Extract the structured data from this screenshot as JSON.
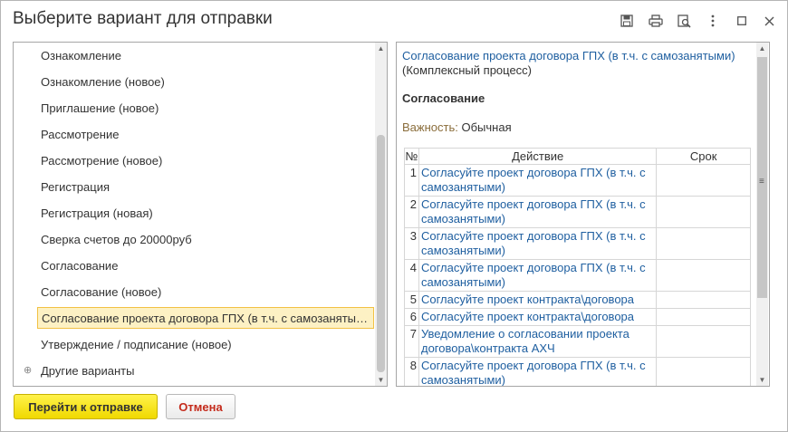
{
  "window": {
    "title": "Выберите вариант для отправки",
    "toolbar": [
      "save-icon",
      "print-icon",
      "preview-icon",
      "more-icon",
      "maximize-icon",
      "close-icon"
    ]
  },
  "variants": {
    "items": [
      "Ознакомление",
      "Ознакомление (новое)",
      "Приглашение (новое)",
      "Рассмотрение",
      "Рассмотрение (новое)",
      "Регистрация",
      "Регистрация (новая)",
      "Сверка счетов до 20000руб",
      "Согласование",
      "Согласование (новое)",
      "Согласование проекта договора ГПХ (в т.ч. с самозанятыми)",
      "Утверждение / подписание (новое)"
    ],
    "selected_index": 10,
    "other_group": "Другие варианты"
  },
  "details": {
    "process_title": "Согласование проекта договора ГПХ (в т.ч. с самозанятыми)",
    "process_type": "(Комплексный процесс)",
    "section": "Согласование",
    "importance_label": "Важность:",
    "importance_value": "Обычная",
    "table": {
      "headers": [
        "№",
        "Действие",
        "Срок"
      ],
      "rows": [
        {
          "n": "1",
          "action": "Согласуйте проект договора ГПХ (в т.ч. с самозанятыми)",
          "term": ""
        },
        {
          "n": "2",
          "action": "Согласуйте проект договора ГПХ (в т.ч. с самозанятыми)",
          "term": ""
        },
        {
          "n": "3",
          "action": "Согласуйте проект договора ГПХ (в т.ч. с самозанятыми)",
          "term": ""
        },
        {
          "n": "4",
          "action": "Согласуйте проект договора ГПХ (в т.ч. с самозанятыми)",
          "term": ""
        },
        {
          "n": "5",
          "action": "Согласуйте проект контракта\\договора",
          "term": ""
        },
        {
          "n": "6",
          "action": "Согласуйте проект контракта\\договора",
          "term": ""
        },
        {
          "n": "7",
          "action": "Уведомление о согласовании проекта договора\\контракта АХЧ",
          "term": ""
        },
        {
          "n": "8",
          "action": "Согласуйте проект договора ГПХ (в т.ч. с самозанятыми)",
          "term": ""
        }
      ]
    }
  },
  "buttons": {
    "go": "Перейти к отправке",
    "cancel": "Отмена"
  },
  "colors": {
    "link": "#1f5fa0",
    "selection_bg": "#fdf1c4",
    "selection_border": "#f2c144",
    "primary_button": "#f5e000",
    "cancel_text": "#c42b1c"
  }
}
